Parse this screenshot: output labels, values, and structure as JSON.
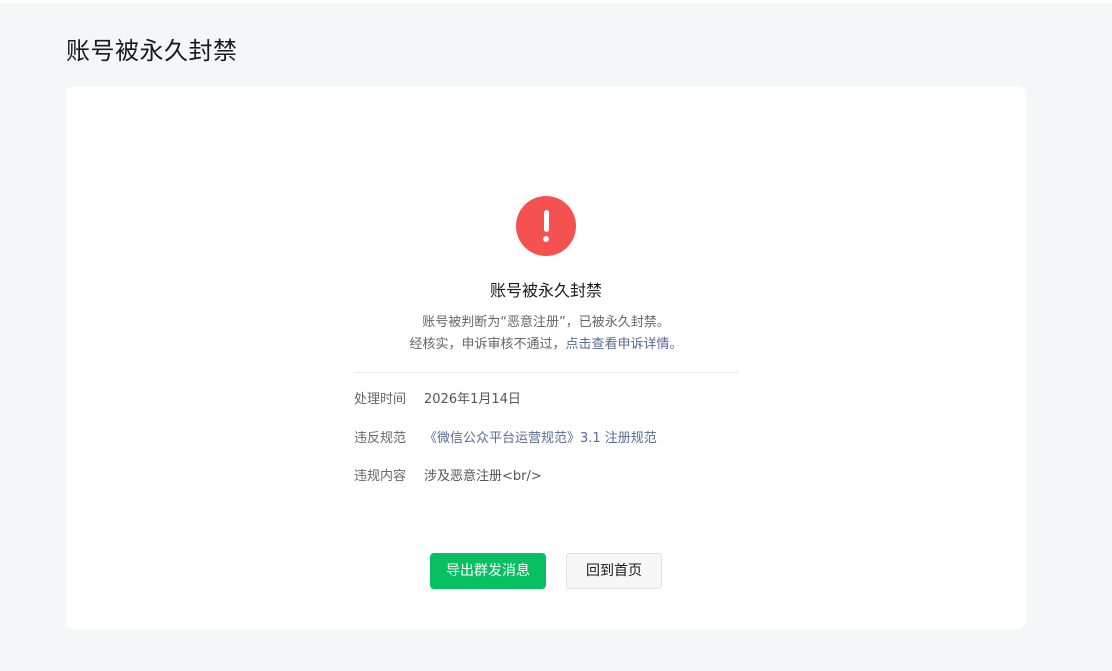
{
  "page": {
    "title": "账号被永久封禁"
  },
  "status": {
    "icon": "exclamation-circle-icon",
    "icon_color": "#f55151",
    "title": "账号被永久封禁",
    "description_line1": "账号被判断为“恶意注册”，已被永久封禁。",
    "description_line2_prefix": "经核实，申诉审核不通过，",
    "description_line2_link": "点击查看申诉详情。"
  },
  "details": {
    "rows": [
      {
        "label": "处理时间",
        "value": "2026年1月14日"
      },
      {
        "label": "违反规范",
        "value": "《微信公众平台运营规范》3.1 注册规范"
      },
      {
        "label": "违规内容",
        "value": "涉及恶意注册<br/>"
      }
    ]
  },
  "actions": {
    "primary_label": "导出群发消息",
    "secondary_label": "回到首页",
    "primary_color": "#07c160"
  }
}
